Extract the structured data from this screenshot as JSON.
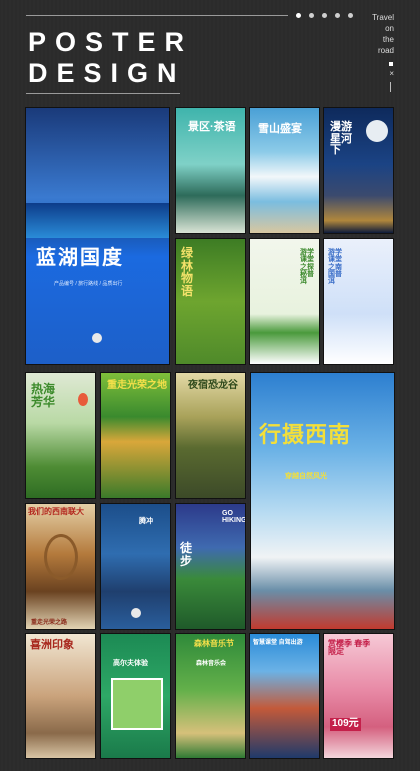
{
  "header": {
    "title_line1": "POSTER",
    "title_line2": "DESIGN",
    "side_lines": [
      "Travel",
      "on",
      "the",
      "road"
    ],
    "close_glyph": "×"
  },
  "posters": [
    {
      "name": "poster-blue-lake",
      "title": "蓝湖国度",
      "sub": "产品编号 / 旅行路线 / 品质出行"
    },
    {
      "name": "poster-teahouse",
      "title": "景区·茶语",
      "sub": ""
    },
    {
      "name": "poster-snow-mountain",
      "title": "雪山盛宴",
      "sub": ""
    },
    {
      "name": "poster-night-sky",
      "title": "漫游星河下",
      "sub": ""
    },
    {
      "name": "poster-green-forest",
      "title": "绿林物语",
      "sub": ""
    },
    {
      "name": "poster-study-tour",
      "title": "游学课堂之探秘普洱",
      "sub": ""
    },
    {
      "name": "poster-study-tour-2",
      "title": "游学课堂之南国普洱",
      "sub": ""
    },
    {
      "name": "poster-hot-air-balloon",
      "title": "热海芳华",
      "sub": ""
    },
    {
      "name": "poster-yellow-wall",
      "title": "重走光荣之地",
      "sub": ""
    },
    {
      "name": "poster-dinosaur-valley",
      "title": "夜宿恐龙谷",
      "sub": ""
    },
    {
      "name": "poster-hiking-travel",
      "title": "行摄西南",
      "sub": "穿越自然风光"
    },
    {
      "name": "poster-old-building",
      "title": "我们的西南联大",
      "sub": "重走光荣之路"
    },
    {
      "name": "poster-temple",
      "title": "腾冲",
      "sub": ""
    },
    {
      "name": "poster-go-hiking",
      "title": "徒步",
      "sub": "GO HIKING"
    },
    {
      "name": "poster-old-street",
      "title": "喜洲印象",
      "sub": ""
    },
    {
      "name": "poster-golf",
      "title": "高尔夫体验",
      "sub": ""
    },
    {
      "name": "poster-forest-music",
      "title": "森林音乐节",
      "sub": "森林音乐会"
    },
    {
      "name": "poster-team-travel",
      "title": "智慧课堂 自驾出游",
      "sub": ""
    },
    {
      "name": "poster-cherry-blossom",
      "title": "赏樱季 春季限定",
      "sub": "109元"
    }
  ]
}
